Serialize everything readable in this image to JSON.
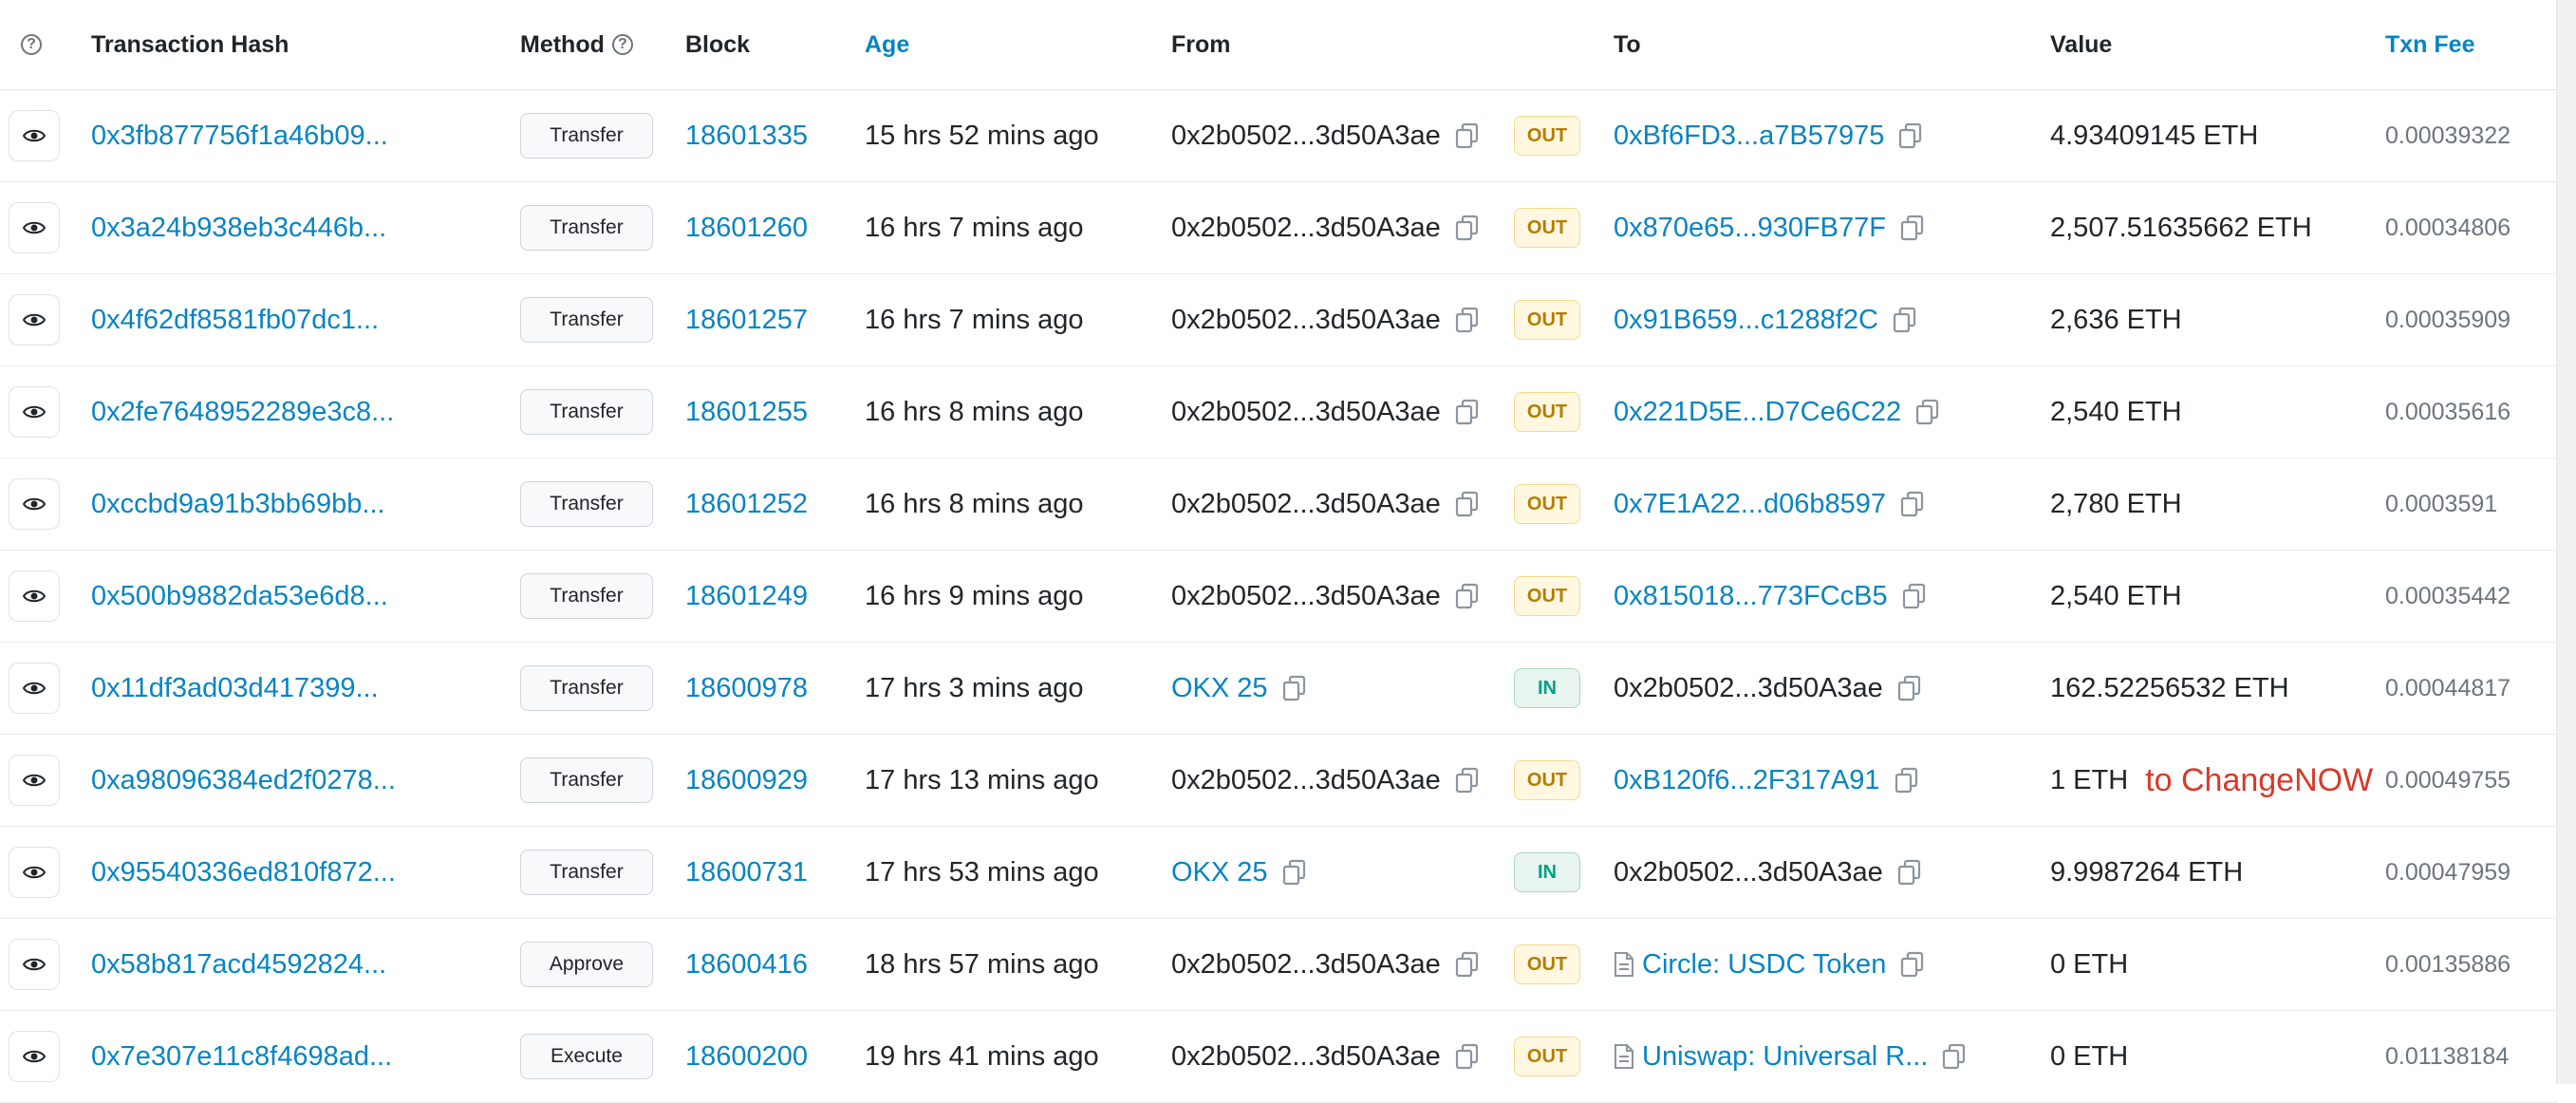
{
  "header": {
    "transaction_hash": "Transaction Hash",
    "method": "Method",
    "block": "Block",
    "age": "Age",
    "from": "From",
    "to": "To",
    "value": "Value",
    "txn_fee": "Txn Fee"
  },
  "rows": [
    {
      "hash": "0x3fb877756f1a46b09...",
      "method": "Transfer",
      "block": "18601335",
      "age": "15 hrs 52 mins ago",
      "from": "0x2b0502...3d50A3ae",
      "from_link": false,
      "dir": "OUT",
      "to": "0xBf6FD3...a7B57975",
      "to_link": true,
      "to_contract": false,
      "value": "4.93409145 ETH",
      "fee": "0.00039322",
      "note": ""
    },
    {
      "hash": "0x3a24b938eb3c446b...",
      "method": "Transfer",
      "block": "18601260",
      "age": "16 hrs 7 mins ago",
      "from": "0x2b0502...3d50A3ae",
      "from_link": false,
      "dir": "OUT",
      "to": "0x870e65...930FB77F",
      "to_link": true,
      "to_contract": false,
      "value": "2,507.51635662 ETH",
      "fee": "0.00034806",
      "note": ""
    },
    {
      "hash": "0x4f62df8581fb07dc1...",
      "method": "Transfer",
      "block": "18601257",
      "age": "16 hrs 7 mins ago",
      "from": "0x2b0502...3d50A3ae",
      "from_link": false,
      "dir": "OUT",
      "to": "0x91B659...c1288f2C",
      "to_link": true,
      "to_contract": false,
      "value": "2,636 ETH",
      "fee": "0.00035909",
      "note": ""
    },
    {
      "hash": "0x2fe7648952289e3c8...",
      "method": "Transfer",
      "block": "18601255",
      "age": "16 hrs 8 mins ago",
      "from": "0x2b0502...3d50A3ae",
      "from_link": false,
      "dir": "OUT",
      "to": "0x221D5E...D7Ce6C22",
      "to_link": true,
      "to_contract": false,
      "value": "2,540 ETH",
      "fee": "0.00035616",
      "note": ""
    },
    {
      "hash": "0xccbd9a91b3bb69bb...",
      "method": "Transfer",
      "block": "18601252",
      "age": "16 hrs 8 mins ago",
      "from": "0x2b0502...3d50A3ae",
      "from_link": false,
      "dir": "OUT",
      "to": "0x7E1A22...d06b8597",
      "to_link": true,
      "to_contract": false,
      "value": "2,780 ETH",
      "fee": "0.0003591",
      "note": ""
    },
    {
      "hash": "0x500b9882da53e6d8...",
      "method": "Transfer",
      "block": "18601249",
      "age": "16 hrs 9 mins ago",
      "from": "0x2b0502...3d50A3ae",
      "from_link": false,
      "dir": "OUT",
      "to": "0x815018...773FCcB5",
      "to_link": true,
      "to_contract": false,
      "value": "2,540 ETH",
      "fee": "0.00035442",
      "note": ""
    },
    {
      "hash": "0x11df3ad03d417399...",
      "method": "Transfer",
      "block": "18600978",
      "age": "17 hrs 3 mins ago",
      "from": "OKX 25",
      "from_link": true,
      "dir": "IN",
      "to": "0x2b0502...3d50A3ae",
      "to_link": false,
      "to_contract": false,
      "value": "162.52256532 ETH",
      "fee": "0.00044817",
      "note": ""
    },
    {
      "hash": "0xa98096384ed2f0278...",
      "method": "Transfer",
      "block": "18600929",
      "age": "17 hrs 13 mins ago",
      "from": "0x2b0502...3d50A3ae",
      "from_link": false,
      "dir": "OUT",
      "to": "0xB120f6...2F317A91",
      "to_link": true,
      "to_contract": false,
      "value": "1 ETH",
      "fee": "0.00049755",
      "note": "to ChangeNOW"
    },
    {
      "hash": "0x95540336ed810f872...",
      "method": "Transfer",
      "block": "18600731",
      "age": "17 hrs 53 mins ago",
      "from": "OKX 25",
      "from_link": true,
      "dir": "IN",
      "to": "0x2b0502...3d50A3ae",
      "to_link": false,
      "to_contract": false,
      "value": "9.9987264 ETH",
      "fee": "0.00047959",
      "note": ""
    },
    {
      "hash": "0x58b817acd4592824...",
      "method": "Approve",
      "block": "18600416",
      "age": "18 hrs 57 mins ago",
      "from": "0x2b0502...3d50A3ae",
      "from_link": false,
      "dir": "OUT",
      "to": "Circle: USDC Token",
      "to_link": true,
      "to_contract": true,
      "value": "0 ETH",
      "fee": "0.00135886",
      "note": ""
    },
    {
      "hash": "0x7e307e11c8f4698ad...",
      "method": "Execute",
      "block": "18600200",
      "age": "19 hrs 41 mins ago",
      "from": "0x2b0502...3d50A3ae",
      "from_link": false,
      "dir": "OUT",
      "to": "Uniswap: Universal R...",
      "to_link": true,
      "to_contract": true,
      "value": "0 ETH",
      "fee": "0.01138184",
      "note": ""
    }
  ],
  "colors": {
    "link": "#0784c3",
    "out_badge": "#b47d00",
    "in_badge": "#00a186",
    "annotation": "#d63a2a"
  },
  "icons": {
    "view": "eye-icon",
    "copy": "copy-icon",
    "help": "question-circle-icon",
    "contract": "document-icon"
  }
}
